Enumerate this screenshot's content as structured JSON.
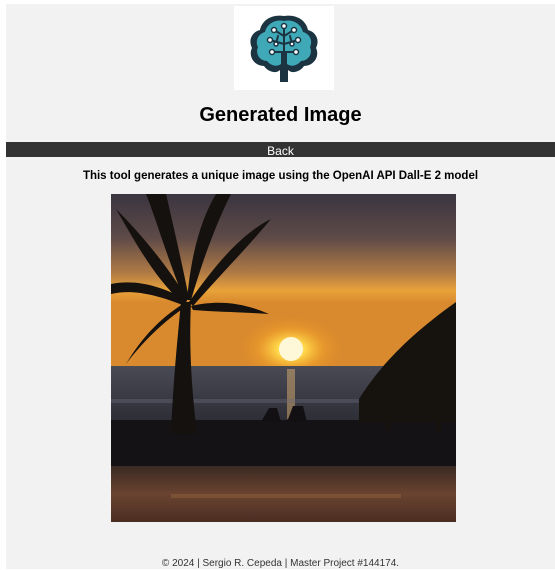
{
  "header": {
    "logo_icon": "brain-circuit-tree-icon",
    "title": "Generated Image"
  },
  "nav": {
    "back_label": "Back"
  },
  "description": "This tool generates a unique image using the OpenAI API Dall-E 2 model",
  "image": {
    "subject": "sunset-beach-palm-icon"
  },
  "footer": {
    "text": "© 2024 | Sergio R. Cepeda | Master Project #144174."
  },
  "colors": {
    "page_background": "#f2f2f2",
    "nav_bar": "#333333",
    "logo_teal": "#3fa9b8",
    "logo_navy": "#1c3442"
  }
}
